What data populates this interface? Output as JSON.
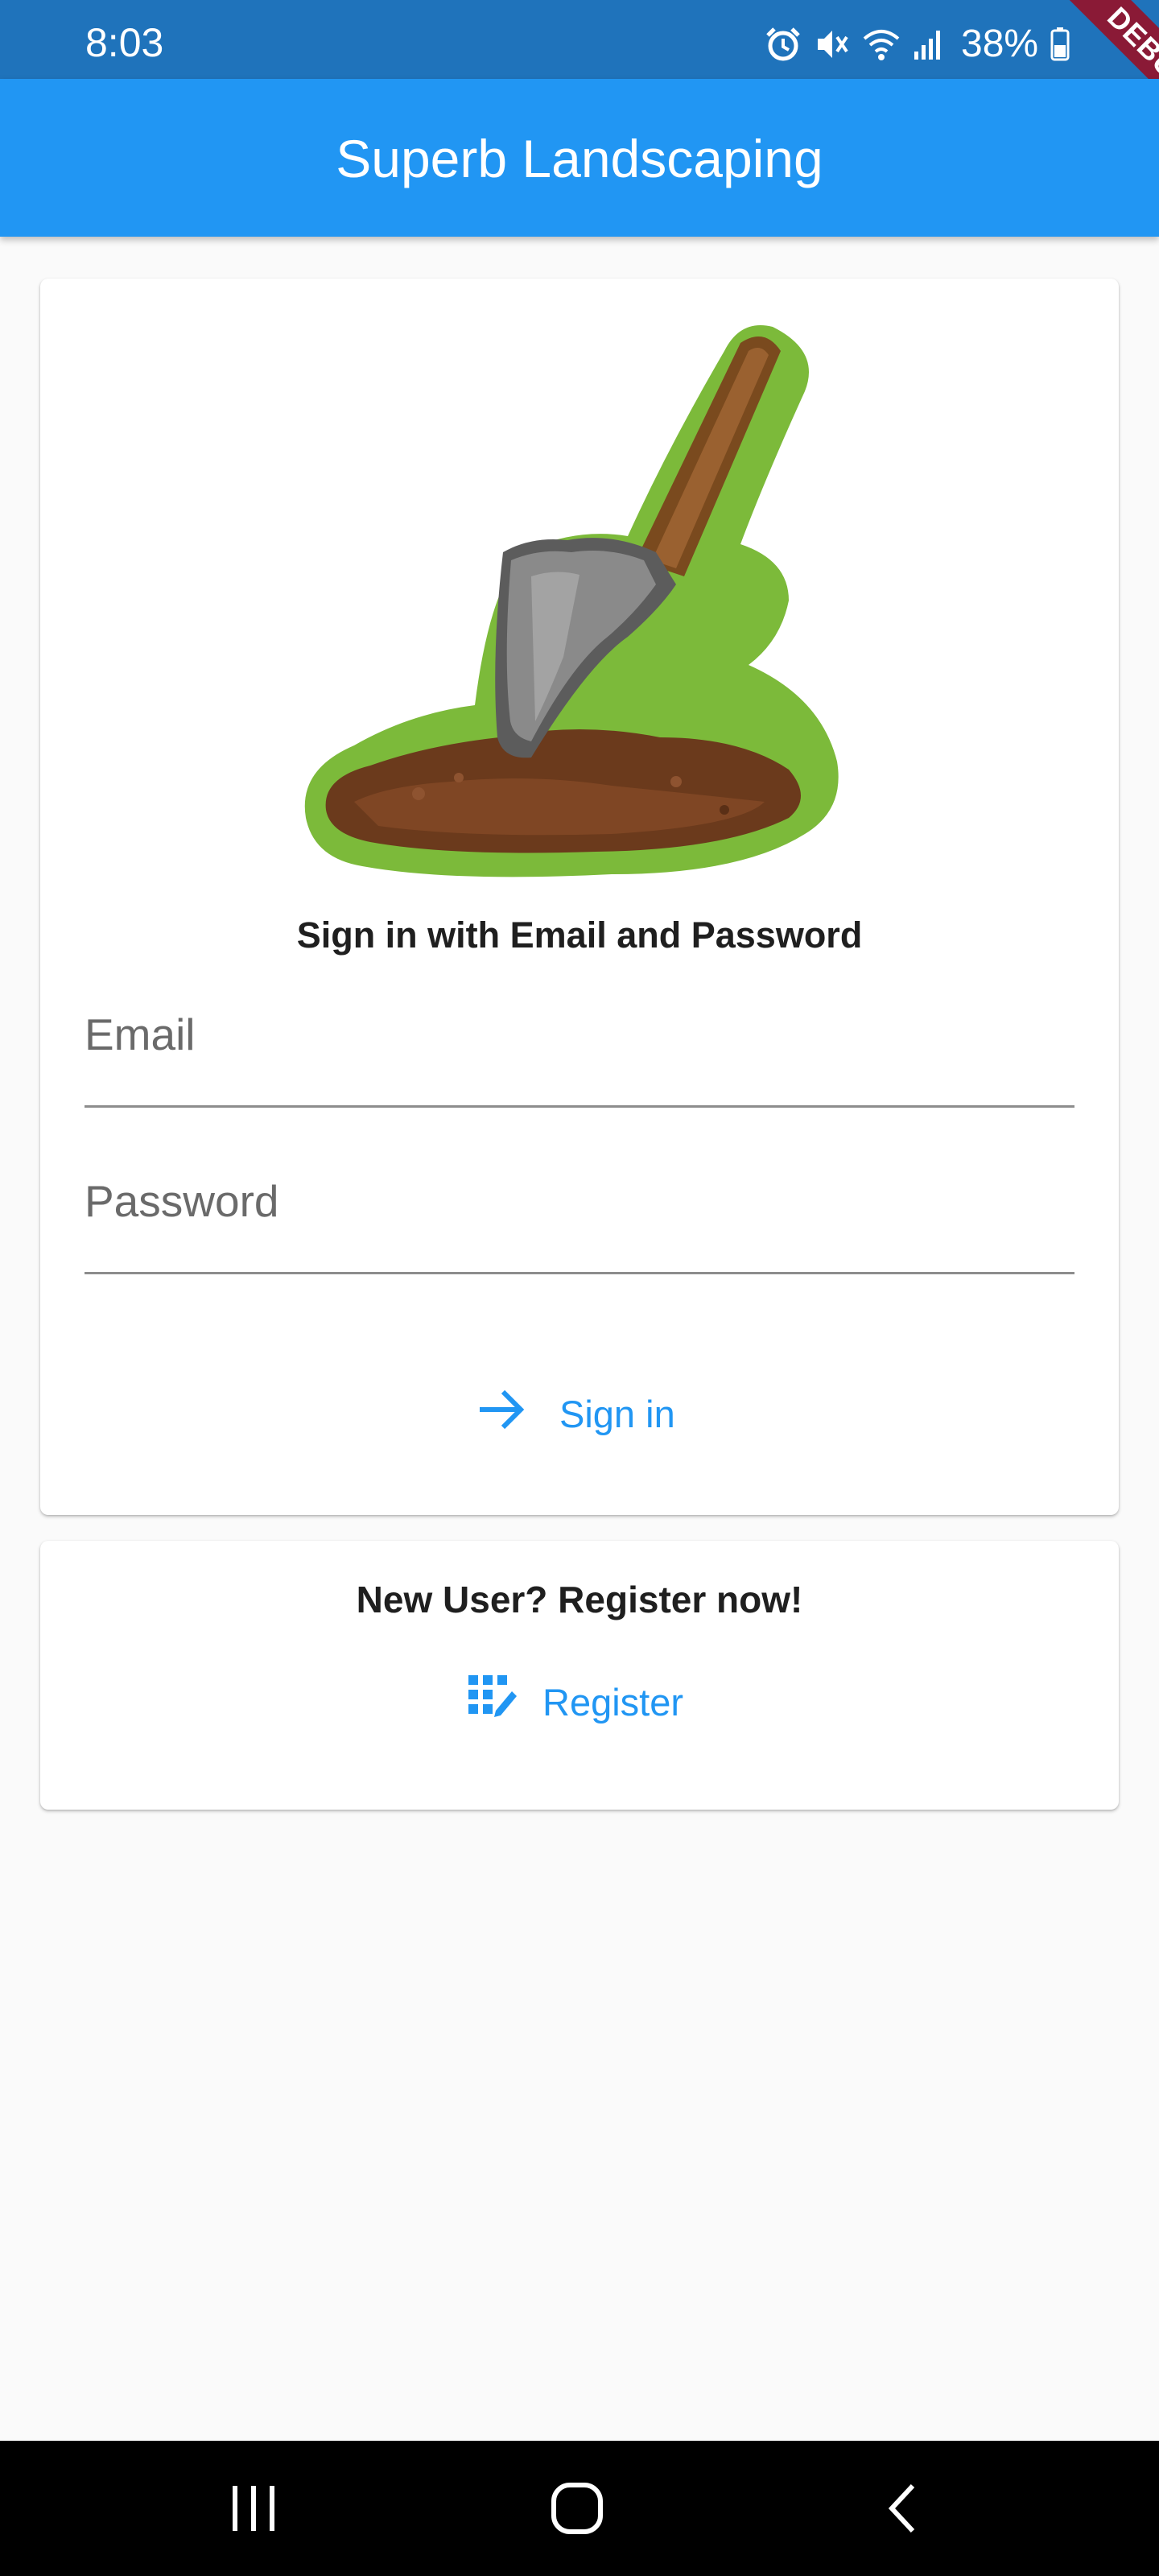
{
  "status_bar": {
    "time": "8:03",
    "battery": "38%",
    "icons": [
      "alarm-icon",
      "mute-icon",
      "wifi-icon",
      "signal-icon",
      "battery-icon"
    ]
  },
  "debug_banner": "DEBUG",
  "app_bar": {
    "title": "Superb Landscaping"
  },
  "signin_card": {
    "logo": "shovel-in-dirt-logo",
    "heading": "Sign in with Email and Password",
    "email_placeholder": "Email",
    "password_placeholder": "Password",
    "signin_label": "Sign in"
  },
  "register_card": {
    "heading": "New User? Register now!",
    "register_label": "Register"
  },
  "nav_bar": {
    "buttons": [
      "recents-icon",
      "home-icon",
      "back-icon"
    ]
  },
  "colors": {
    "status_bar": "#1f73bb",
    "app_bar": "#2196f3",
    "accent": "#2196f3",
    "background": "#fafafa",
    "debug_ribbon": "#8a1a36"
  }
}
